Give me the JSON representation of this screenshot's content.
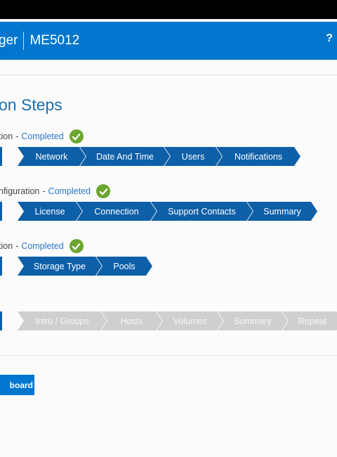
{
  "header": {
    "app_name_partial": "ger",
    "system_name": "ME5012",
    "help_label": "?"
  },
  "page_title_partial": "on Steps",
  "sections": [
    {
      "label_partial": "tion",
      "separator": "-",
      "status": "Completed",
      "steps": [
        "Network",
        "Date And Time",
        "Users",
        "Notifications"
      ]
    },
    {
      "label_partial": "nfiguration",
      "separator": "-",
      "status": "Completed",
      "steps": [
        "License",
        "Connection",
        "Support Contacts",
        "Summary"
      ]
    },
    {
      "label_partial": "tion",
      "separator": "-",
      "status": "Completed",
      "steps": [
        "Storage Type",
        "Pools"
      ]
    },
    {
      "steps": [
        "Intro / Groups",
        "Hosts",
        "Volumes",
        "Summary",
        "Repeat"
      ]
    }
  ],
  "dashboard_button_partial": "board",
  "colors": {
    "header_blue": "#0076ce",
    "step_done": "#0d5fa8",
    "step_todo": "#cfcfcf",
    "completed_text": "#2d78c8",
    "check_green": "#6ca530"
  }
}
